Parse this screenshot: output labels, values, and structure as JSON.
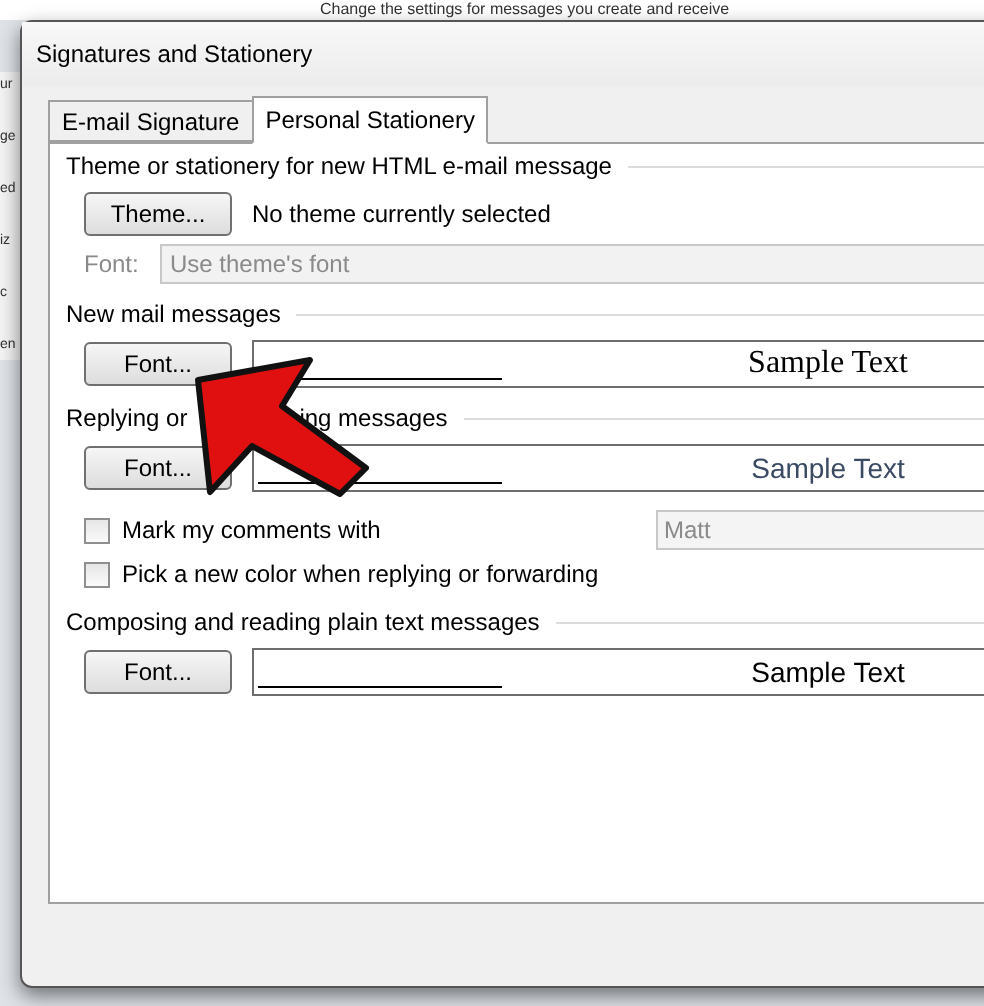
{
  "background": {
    "heading": "Change the settings for messages you create and receive",
    "fragments": [
      "ur",
      "ge",
      "ed",
      "iz",
      "c",
      "en"
    ]
  },
  "window": {
    "title": "Signatures and Stationery"
  },
  "tabs": [
    {
      "label": "E-mail Signature",
      "selected": false
    },
    {
      "label": "Personal Stationery",
      "selected": true
    }
  ],
  "sections": [
    {
      "title": [
        "Theme or stationery for new HTML e-mail message"
      ],
      "rows": [
        {
          "kind": "button_text",
          "button": "Theme...",
          "text": "No theme currently selected"
        },
        {
          "kind": "disabled_field",
          "label": "Font:",
          "value": "Use theme's font"
        }
      ]
    },
    {
      "title": [
        "New mail messages"
      ],
      "rows": [
        {
          "kind": "preview",
          "button": "Font...",
          "preview": "Sample Text"
        }
      ]
    },
    {
      "title": [
        "Replying or",
        "ing messages"
      ],
      "rows": [
        {
          "kind": "preview",
          "button": "Font...",
          "preview": "Sample Text"
        },
        {
          "kind": "checkbox",
          "label": "Mark my comments with",
          "checked": false,
          "value": "Matt"
        },
        {
          "kind": "checkbox",
          "label": "Pick a new color when replying or forwarding",
          "checked": false
        }
      ]
    },
    {
      "title": [
        "Composing and reading plain text messages"
      ],
      "rows": [
        {
          "kind": "preview",
          "button": "Font...",
          "preview": "Sample Text"
        }
      ]
    }
  ]
}
